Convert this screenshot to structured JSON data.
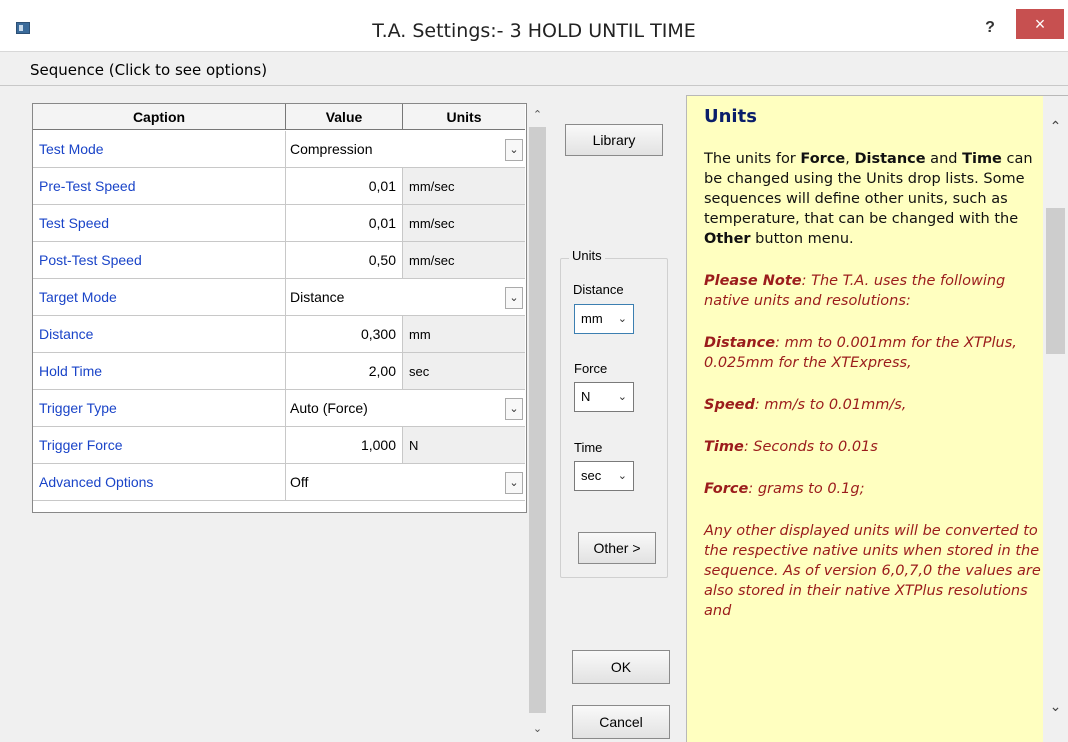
{
  "window": {
    "title": "T.A. Settings:- 3 HOLD UNTIL TIME",
    "help_label": "?",
    "close_label": "×"
  },
  "menu": {
    "sequence_label": "Sequence (Click to see options)"
  },
  "table": {
    "headers": {
      "caption": "Caption",
      "value": "Value",
      "units": "Units"
    },
    "rows": [
      {
        "caption": "Test Mode",
        "value": "Compression",
        "kind": "drop"
      },
      {
        "caption": "Pre-Test Speed",
        "value": "0,01",
        "unit": "mm/sec"
      },
      {
        "caption": "Test Speed",
        "value": "0,01",
        "unit": "mm/sec"
      },
      {
        "caption": "Post-Test Speed",
        "value": "0,50",
        "unit": "mm/sec"
      },
      {
        "caption": "Target Mode",
        "value": "Distance",
        "kind": "drop"
      },
      {
        "caption": "Distance",
        "value": "0,300",
        "unit": "mm"
      },
      {
        "caption": "Hold Time",
        "value": "2,00",
        "unit": "sec"
      },
      {
        "caption": "Trigger Type",
        "value": "Auto (Force)",
        "kind": "drop"
      },
      {
        "caption": "Trigger Force",
        "value": "1,000",
        "unit": "N"
      },
      {
        "caption": "Advanced Options",
        "value": "Off",
        "kind": "drop"
      }
    ]
  },
  "buttons": {
    "library": "Library",
    "other": "Other  >",
    "ok": "OK",
    "cancel": "Cancel"
  },
  "units": {
    "group_label": "Units",
    "distance_label": "Distance",
    "distance_value": "mm",
    "force_label": "Force",
    "force_value": "N",
    "time_label": "Time",
    "time_value": "sec"
  },
  "help": {
    "title": "Units",
    "p1_a": "The units for ",
    "p1_force": "Force",
    "p1_b": ", ",
    "p1_distance": "Distance",
    "p1_c": " and ",
    "p1_time": "Time",
    "p1_d": " can be changed using the Units drop lists. Some sequences will define other units, such as temperature, that can be changed with the ",
    "p1_other": "Other",
    "p1_e": " button menu.",
    "note_label": "Please Note",
    "note_text": ": The T.A. uses the following native units and resolutions:",
    "distance_label": "Distance",
    "distance_text": ": mm to 0.001mm for the XTPlus, 0.025mm for the XTExpress,",
    "speed_label": "Speed",
    "speed_text": ": mm/s to 0.01mm/s,",
    "time_label": "Time",
    "time_text": ": Seconds to 0.01s",
    "force_label": "Force",
    "force_text": ": grams to 0.1g;",
    "final_text": "Any other displayed units will be converted to the respective native units when stored in the sequence. As of version 6,0,7,0 the values are also stored in their native XTPlus resolutions and"
  },
  "colors": {
    "caption_text": "#1a44c8",
    "help_bg": "#ffffc0",
    "close_bg": "#c75050",
    "note_red": "#9b1c1c"
  }
}
